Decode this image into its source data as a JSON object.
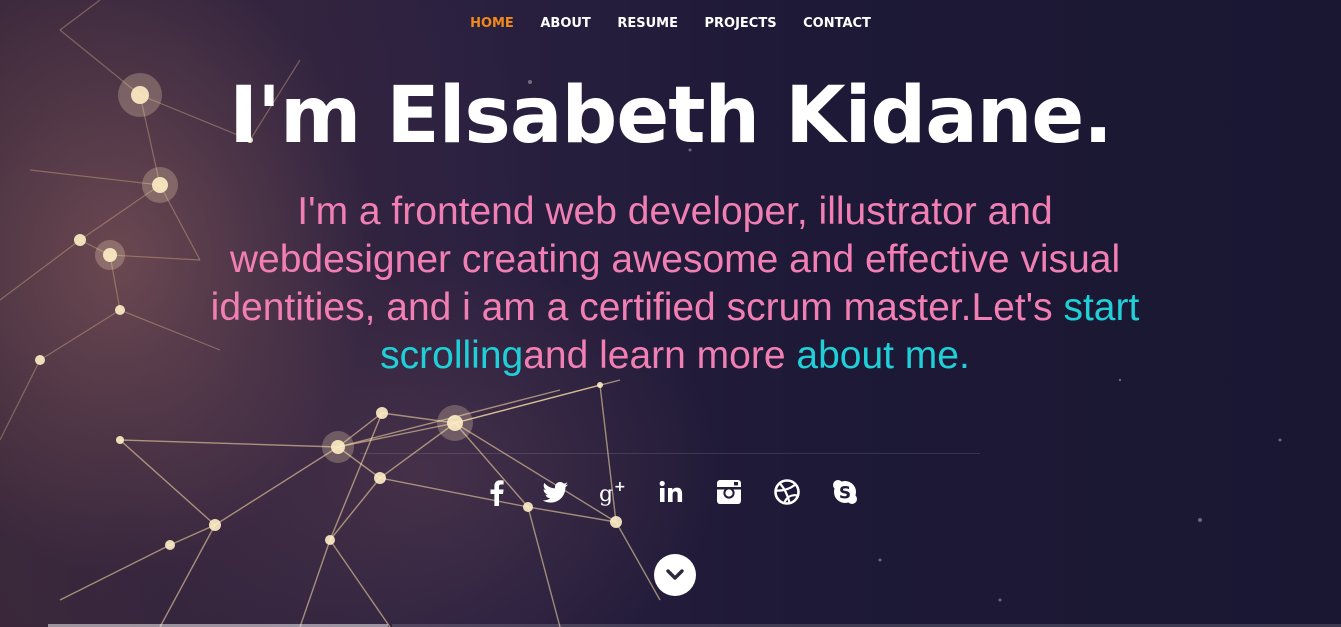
{
  "nav": {
    "items": [
      {
        "label": "HOME",
        "active": true
      },
      {
        "label": "ABOUT",
        "active": false
      },
      {
        "label": "RESUME",
        "active": false
      },
      {
        "label": "PROJECTS",
        "active": false
      },
      {
        "label": "CONTACT",
        "active": false
      }
    ]
  },
  "hero": {
    "headline": "I'm Elsabeth Kidane.",
    "intro_part1": "I'm a frontend web developer, illustrator and webdesigner creating awesome and effective visual identities, and i am a certified scrum master.Let's ",
    "intro_link1": "start scrolling",
    "intro_part2": "and learn more ",
    "intro_link2": "about me",
    "intro_part3": "."
  },
  "social": [
    {
      "icon": "facebook-icon"
    },
    {
      "icon": "twitter-icon"
    },
    {
      "icon": "google-plus-icon"
    },
    {
      "icon": "linkedin-icon"
    },
    {
      "icon": "instagram-icon"
    },
    {
      "icon": "dribbble-icon"
    },
    {
      "icon": "skype-icon"
    }
  ],
  "scroll_button": {
    "icon": "chevron-down-icon"
  },
  "colors": {
    "nav_active": "#f28a1a",
    "intro_text": "#f17fb3",
    "link": "#1fd0d8",
    "background": "#1b1733"
  }
}
